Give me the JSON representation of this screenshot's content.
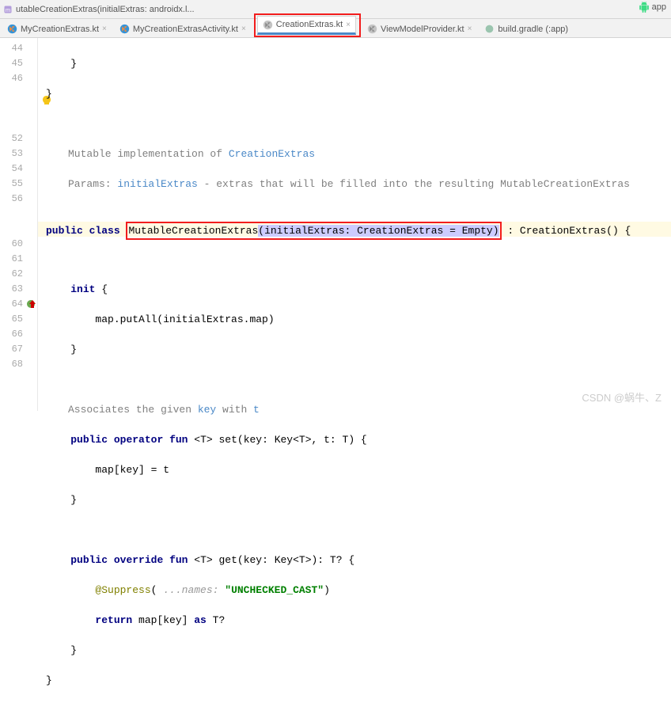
{
  "breadcrumb": "utableCreationExtras(initialExtras: androidx.l...",
  "top_right": "app",
  "tabs": [
    {
      "label": "MyCreationExtras.kt",
      "type": "kt"
    },
    {
      "label": "MyCreationExtrasActivity.kt",
      "type": "kt"
    },
    {
      "label": "CreationExtras.kt",
      "type": "kt",
      "active": true,
      "highlighted": true
    },
    {
      "label": "ViewModelProvider.kt",
      "type": "kt"
    },
    {
      "label": "build.gradle (:app)",
      "type": "gradle"
    }
  ],
  "gutter": [
    "44",
    "45",
    "46",
    "",
    "",
    "",
    "52",
    "53",
    "54",
    "55",
    "56",
    "",
    "",
    "60",
    "61",
    "62",
    "63",
    "64",
    "65",
    "66",
    "67",
    "68"
  ],
  "doc": {
    "line1_a": "Mutable implementation of ",
    "line1_b": "CreationExtras",
    "line2_a": "Params: ",
    "line2_b": "initialExtras",
    "line2_c": " - extras that will be filled into the resulting MutableCreationExtras"
  },
  "code": {
    "l44": "    }",
    "l45": "}",
    "l52_kw1": "public",
    "l52_kw2": "class",
    "l52_name": "MutableCreationExtras",
    "l52_sig": "(initialExtras: CreationExtras = Empty)",
    "l52_tail": " : CreationExtras() {",
    "l54_kw": "init",
    "l54_brace": " {",
    "l55": "        map.putAll(initialExtras.map)",
    "l56": "    }",
    "assoc_a": "Associates the given ",
    "assoc_b": "key",
    "assoc_c": " with ",
    "assoc_d": "t",
    "l60_kw1": "public",
    "l60_kw2": "operator",
    "l60_kw3": "fun",
    "l60_sig": " <T> set(key: Key<T>, t: T) {",
    "l61": "        map[key] = t",
    "l62": "    }",
    "l64_kw1": "public",
    "l64_kw2": "override",
    "l64_kw3": "fun",
    "l64_sig": " <T> get(key: Key<T>): T? {",
    "l65_ann": "@Suppress",
    "l65_hint": "...names: ",
    "l65_str": "\"UNCHECKED_CAST\"",
    "l65_close": ")",
    "l66_kw": "return",
    "l66_a": " map[key] ",
    "l66_as": "as",
    "l66_b": " T?",
    "l67": "    }",
    "l68": "}"
  },
  "watermark": "CSDN @蜗牛、Z"
}
